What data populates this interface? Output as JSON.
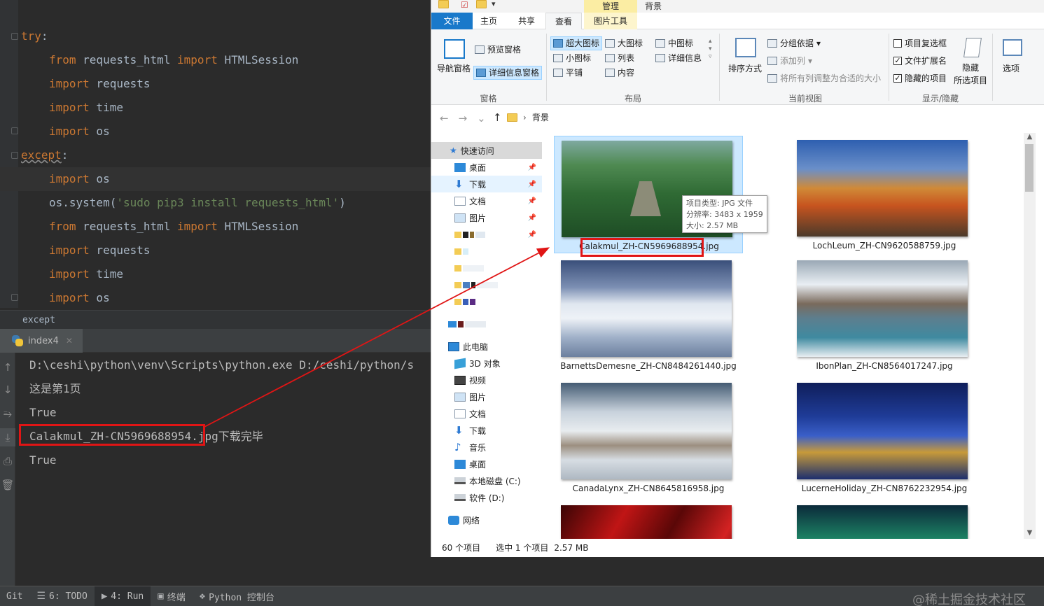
{
  "ide": {
    "code": [
      {
        "kw": "",
        "text": "try",
        "tail": ":"
      },
      {
        "kw": "from",
        "text": " requests_html ",
        "kw2": "import",
        "tail": " HTMLSession"
      },
      {
        "kw": "import",
        "text": " requests"
      },
      {
        "kw": "import",
        "text": " time"
      },
      {
        "kw": "import",
        "text": " os"
      },
      {
        "kw": "",
        "text": "except",
        "tail": ":"
      },
      {
        "kw": "import",
        "text": " os"
      },
      {
        "plain": "os.system(",
        "str": "'sudo pip3 install requests_html'",
        "tail": ")"
      },
      {
        "kw": "from",
        "text": " requests_html ",
        "kw2": "import",
        "tail": " HTMLSession"
      },
      {
        "kw": "import",
        "text": " requests"
      },
      {
        "kw": "import",
        "text": " time"
      },
      {
        "kw": "import",
        "text": " os"
      }
    ],
    "breadcrumb": "except",
    "run_tab": "index4",
    "console": [
      "D:\\ceshi\\python\\venv\\Scripts\\python.exe D:/ceshi/python/s",
      "这是第1页",
      "True",
      "Calakmul_ZH-CN5969688954.jpg下载完毕",
      "True"
    ]
  },
  "statusbar": {
    "git": "Git",
    "todo": "6: TODO",
    "run": "4: Run",
    "terminal": "终端",
    "python_console": "Python 控制台",
    "watermark": "@稀土掘金技术社区"
  },
  "explorer": {
    "context_tab_header": "管理",
    "window_title": "背景",
    "tabs": {
      "file": "文件",
      "home": "主页",
      "share": "共享",
      "view": "查看",
      "picture_tools": "图片工具"
    },
    "ribbon": {
      "nav_pane": "导航窗格",
      "preview_pane": "预览窗格",
      "details_pane": "详细信息窗格",
      "pane_group": "窗格",
      "extra_large": "超大图标",
      "large": "大图标",
      "medium": "中图标",
      "small": "小图标",
      "list": "列表",
      "details": "详细信息",
      "tiles": "平铺",
      "content": "内容",
      "layout_group": "布局",
      "sort_by": "排序方式",
      "group_by": "分组依据",
      "add_columns": "添加列",
      "fit_columns": "将所有列调整为合适的大小",
      "current_view_group": "当前视图",
      "item_checkboxes": "项目复选框",
      "file_extensions": "文件扩展名",
      "hidden_items": "隐藏的项目",
      "hide_selected": "隐藏\n所选项目",
      "show_hide_group": "显示/隐藏",
      "options": "选项"
    },
    "checks": {
      "item_checkboxes": false,
      "file_extensions": true,
      "hidden_items": true
    },
    "path": "背景",
    "nav": {
      "quick_access": "快速访问",
      "desktop": "桌面",
      "downloads": "下载",
      "documents": "文档",
      "pictures": "图片",
      "this_pc": "此电脑",
      "objects_3d": "3D 对象",
      "videos": "视频",
      "pc_pictures": "图片",
      "pc_documents": "文档",
      "pc_downloads": "下载",
      "music": "音乐",
      "pc_desktop": "桌面",
      "drive_c": "本地磁盘 (C:)",
      "drive_d": "软件 (D:)",
      "network": "网络"
    },
    "files": [
      {
        "name": "Calakmul_ZH-CN5969688954.jpg"
      },
      {
        "name": "LochLeum_ZH-CN9620588759.jpg"
      },
      {
        "name": "BarnettsDemesne_ZH-CN8484261440.jpg"
      },
      {
        "name": "IbonPlan_ZH-CN8564017247.jpg"
      },
      {
        "name": "CanadaLynx_ZH-CN8645816958.jpg"
      },
      {
        "name": "LucerneHoliday_ZH-CN8762232954.jpg"
      }
    ],
    "tooltip": {
      "type": "项目类型: JPG 文件",
      "resolution": "分辨率: 3483 x 1959",
      "size": "大小: 2.57 MB"
    },
    "status": {
      "count": "60 个项目",
      "selected": "选中 1 个项目",
      "size": "2.57 MB"
    }
  },
  "colors": {
    "keyword": "#cc7832",
    "string": "#6a8759",
    "highlight_box": "#e01515",
    "file_tab": "#1979ca"
  }
}
